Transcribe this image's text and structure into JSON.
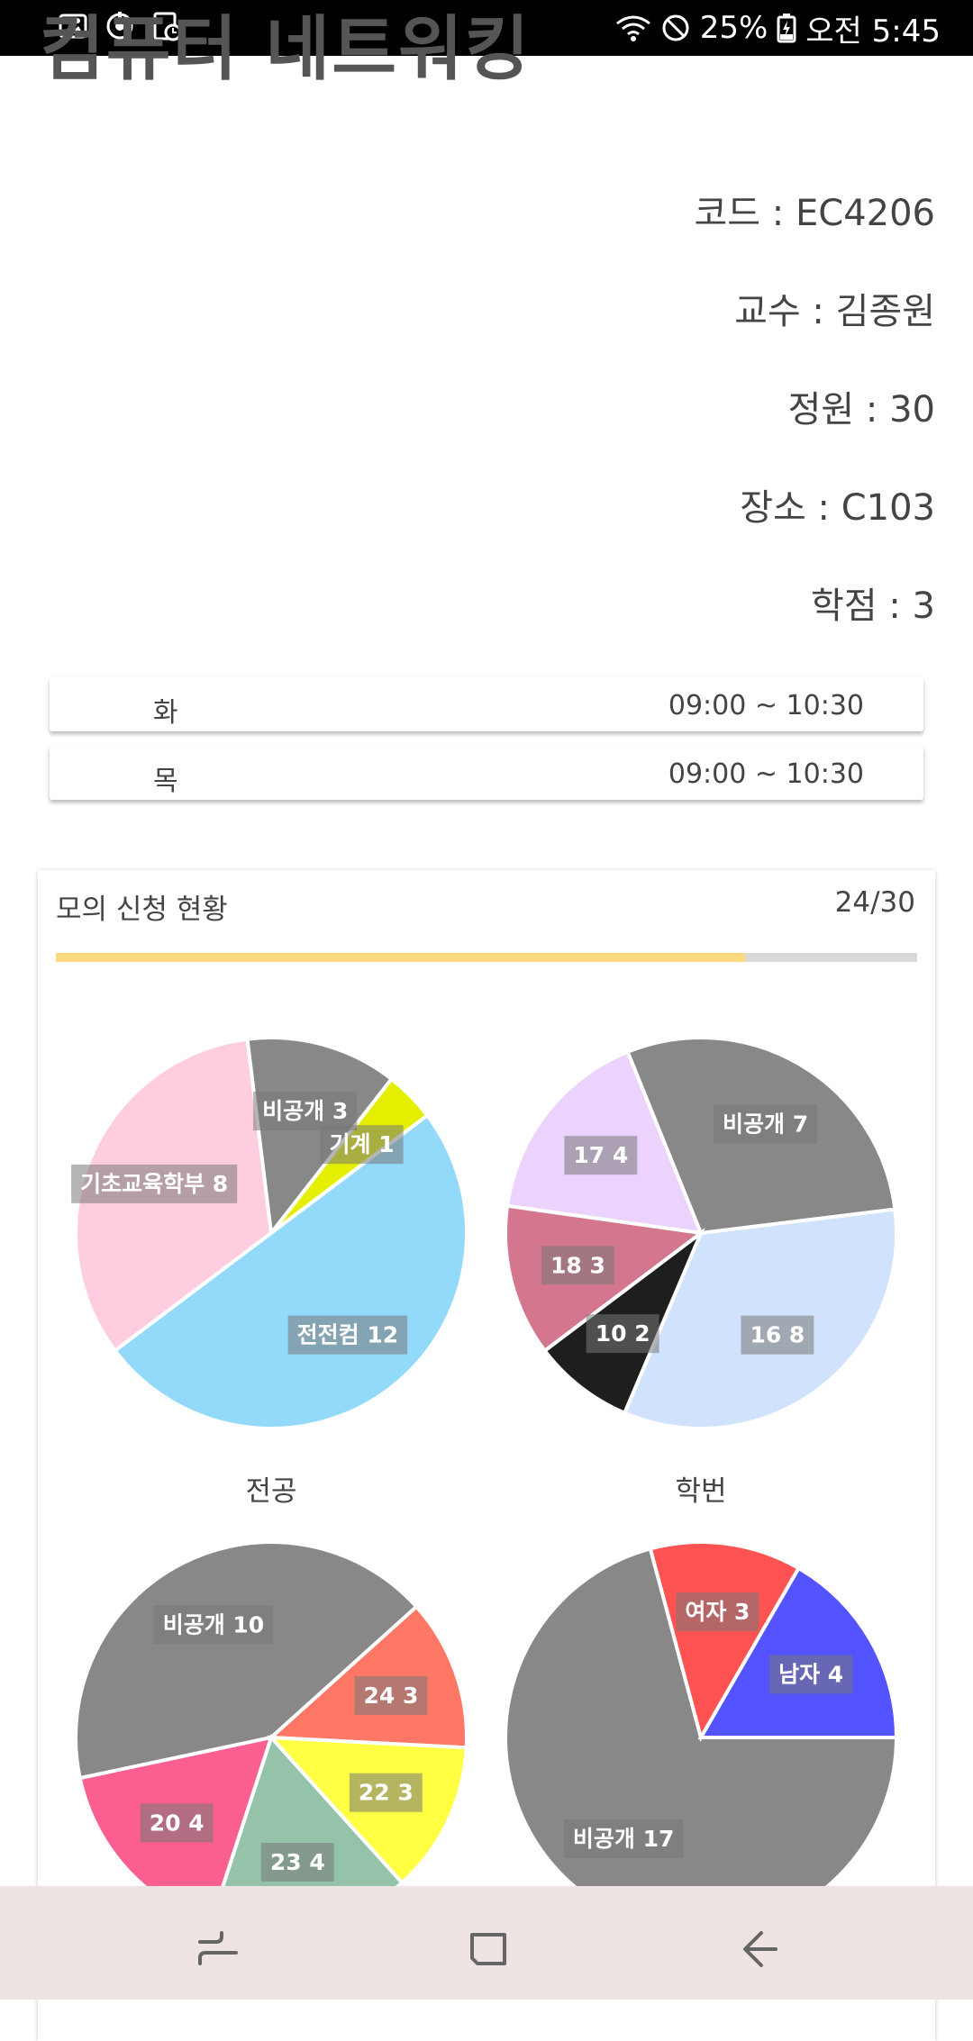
{
  "status_bar": {
    "battery": "25%",
    "time": "오전 5:45",
    "icons": [
      "image-icon",
      "sync-icon",
      "schedule-icon",
      "wifi-icon",
      "do-not-disturb-icon",
      "battery-icon"
    ]
  },
  "course": {
    "title": "컴퓨터 네트워킹",
    "code": "코드 : EC4206",
    "professor": "교수 : 김종원",
    "capacity": "정원 : 30",
    "location": "장소 : C103",
    "credits": "학점 : 3"
  },
  "schedule": [
    {
      "day": "화",
      "time": "09:00 ~ 10:30"
    },
    {
      "day": "목",
      "time": "09:00 ~ 10:30"
    }
  ],
  "application": {
    "title": "모의 신청 현황",
    "count": "24/30",
    "progress": 0.8
  },
  "colors": {
    "progress_fill": "#fcd97e",
    "progress_track": "#d9d9d9",
    "label_bg": "rgba(120,120,120,0.55)"
  },
  "chart_data": [
    {
      "type": "pie",
      "title": "전공",
      "slices": [
        {
          "label": "기초교육학부",
          "value": 8,
          "color": "#ffcde0"
        },
        {
          "label": "비공개",
          "value": 3,
          "color": "#888888"
        },
        {
          "label": "기계",
          "value": 1,
          "color": "#e4ef00"
        },
        {
          "label": "전전컴",
          "value": 12,
          "color": "#92d9fa"
        }
      ]
    },
    {
      "type": "pie",
      "title": "학번",
      "slices": [
        {
          "label": "17",
          "value": 4,
          "color": "#ecd3fd"
        },
        {
          "label": "비공개",
          "value": 7,
          "color": "#888888"
        },
        {
          "label": "16",
          "value": 8,
          "color": "#d1e2fd"
        },
        {
          "label": "10",
          "value": 2,
          "color": "#1e1e1e"
        },
        {
          "label": "18",
          "value": 3,
          "color": "#d4778e"
        }
      ]
    },
    {
      "type": "pie",
      "title": "",
      "slices": [
        {
          "label": "비공개",
          "value": 10,
          "color": "#888888"
        },
        {
          "label": "24",
          "value": 3,
          "color": "#ff7866"
        },
        {
          "label": "22",
          "value": 3,
          "color": "#ffff44"
        },
        {
          "label": "23",
          "value": 4,
          "color": "#95c3aa"
        },
        {
          "label": "20",
          "value": 4,
          "color": "#fb5f90"
        }
      ]
    },
    {
      "type": "pie",
      "title": "",
      "slices": [
        {
          "label": "비공개",
          "value": 17,
          "color": "#888888"
        },
        {
          "label": "여자",
          "value": 3,
          "color": "#ff5252"
        },
        {
          "label": "남자",
          "value": 4,
          "color": "#5353ff"
        }
      ]
    }
  ]
}
